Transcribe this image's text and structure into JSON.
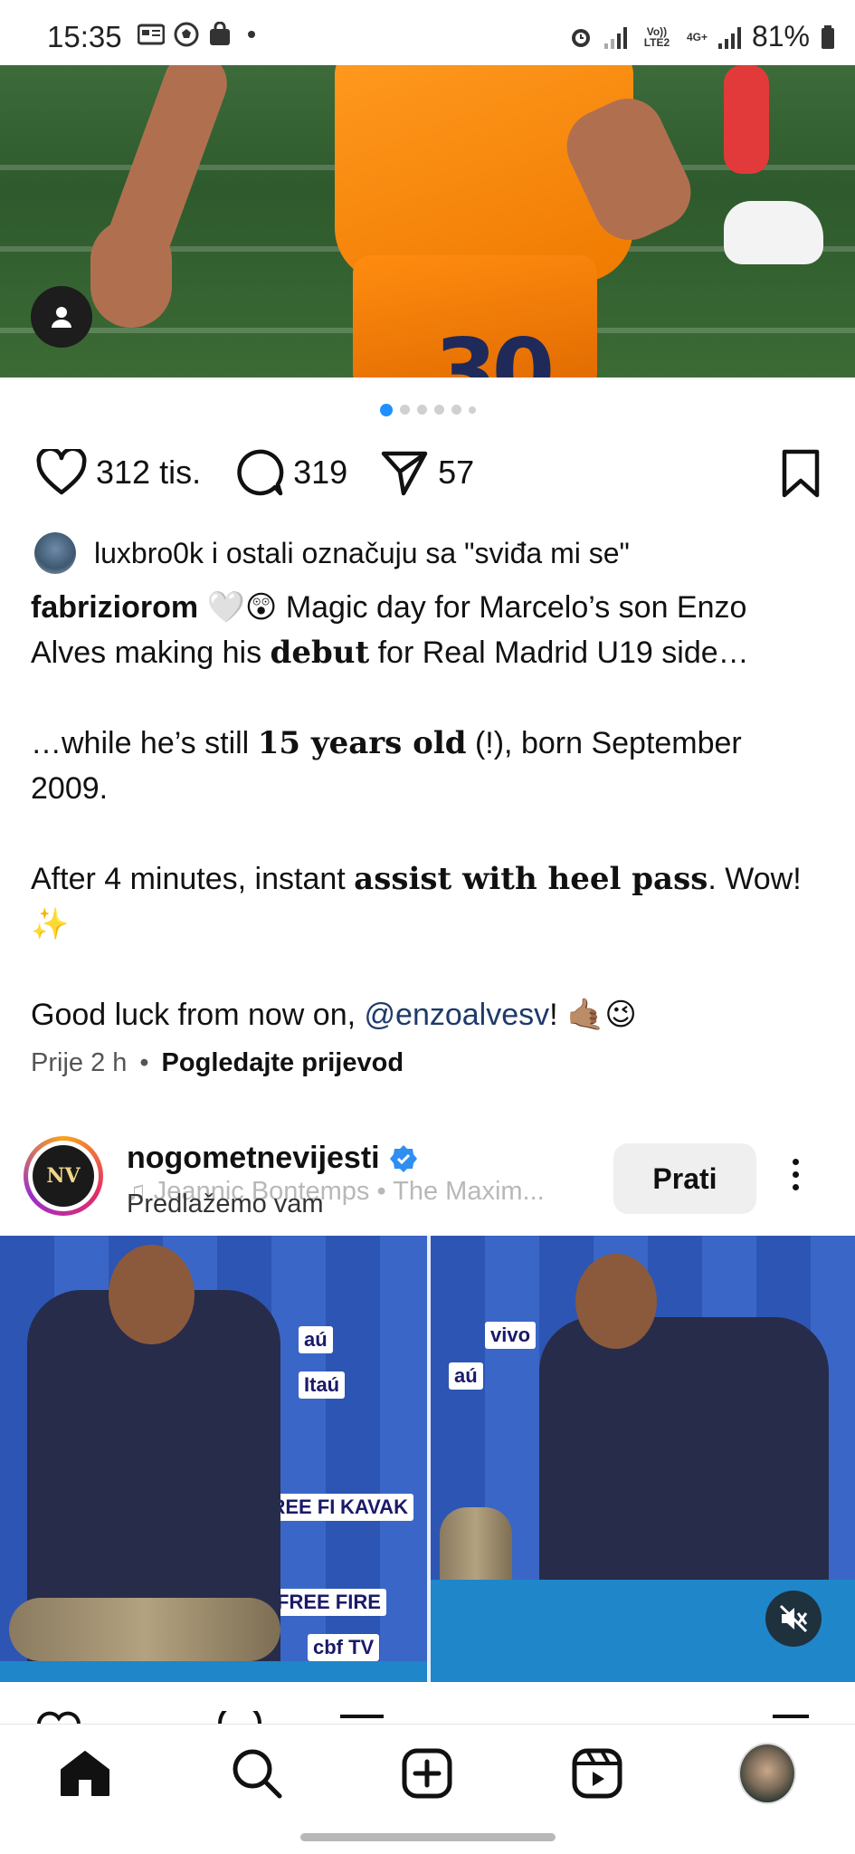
{
  "status_bar": {
    "time": "15:35",
    "network_label": "Vo)) LTE2",
    "network_type": "4G+",
    "battery": "81%"
  },
  "post1": {
    "carousel": {
      "total_slides": 6,
      "active_index": 0
    },
    "likes": "312 tis.",
    "comments": "319",
    "shares": "57",
    "liked_by": "luxbro0k i ostali označuju sa \"sviđa mi se\"",
    "caption": {
      "username": "fabriziorom",
      "emoji1": "🤍😲",
      "line1_a": "Magic day for Marcelo’s son Enzo Alves making his ",
      "line1_bold": "debut",
      "line1_b": " for Real Madrid U19 side…",
      "line2_a": "…while he’s still ",
      "line2_bold": "15 years old",
      "line2_b": " (!), born September 2009.",
      "line3_a": "After 4 minutes, instant ",
      "line3_bold": "assist with heel pass",
      "line3_b": ". Wow! ✨",
      "line4_a": "Good luck from now on, ",
      "line4_mention": "@enzoalvesv",
      "line4_b": "! 🤙🏽😉"
    },
    "time_ago": "Prije 2 h",
    "separator": "•",
    "translate_label": "Pogledajte prijevod"
  },
  "post2": {
    "username": "nogometnevijesti",
    "logo_text": "NV",
    "music": "♫ Jeannic Bontemps • The Maxim...",
    "suggested_label": "Predlažemo vam",
    "follow_label": "Prati"
  },
  "bottom_nav": {
    "items": [
      "home",
      "search",
      "create",
      "reels",
      "profile"
    ],
    "active": "home"
  },
  "colors": {
    "accent_blue": "#1e90ff",
    "follow_bg": "#efefef",
    "text": "#111111"
  }
}
